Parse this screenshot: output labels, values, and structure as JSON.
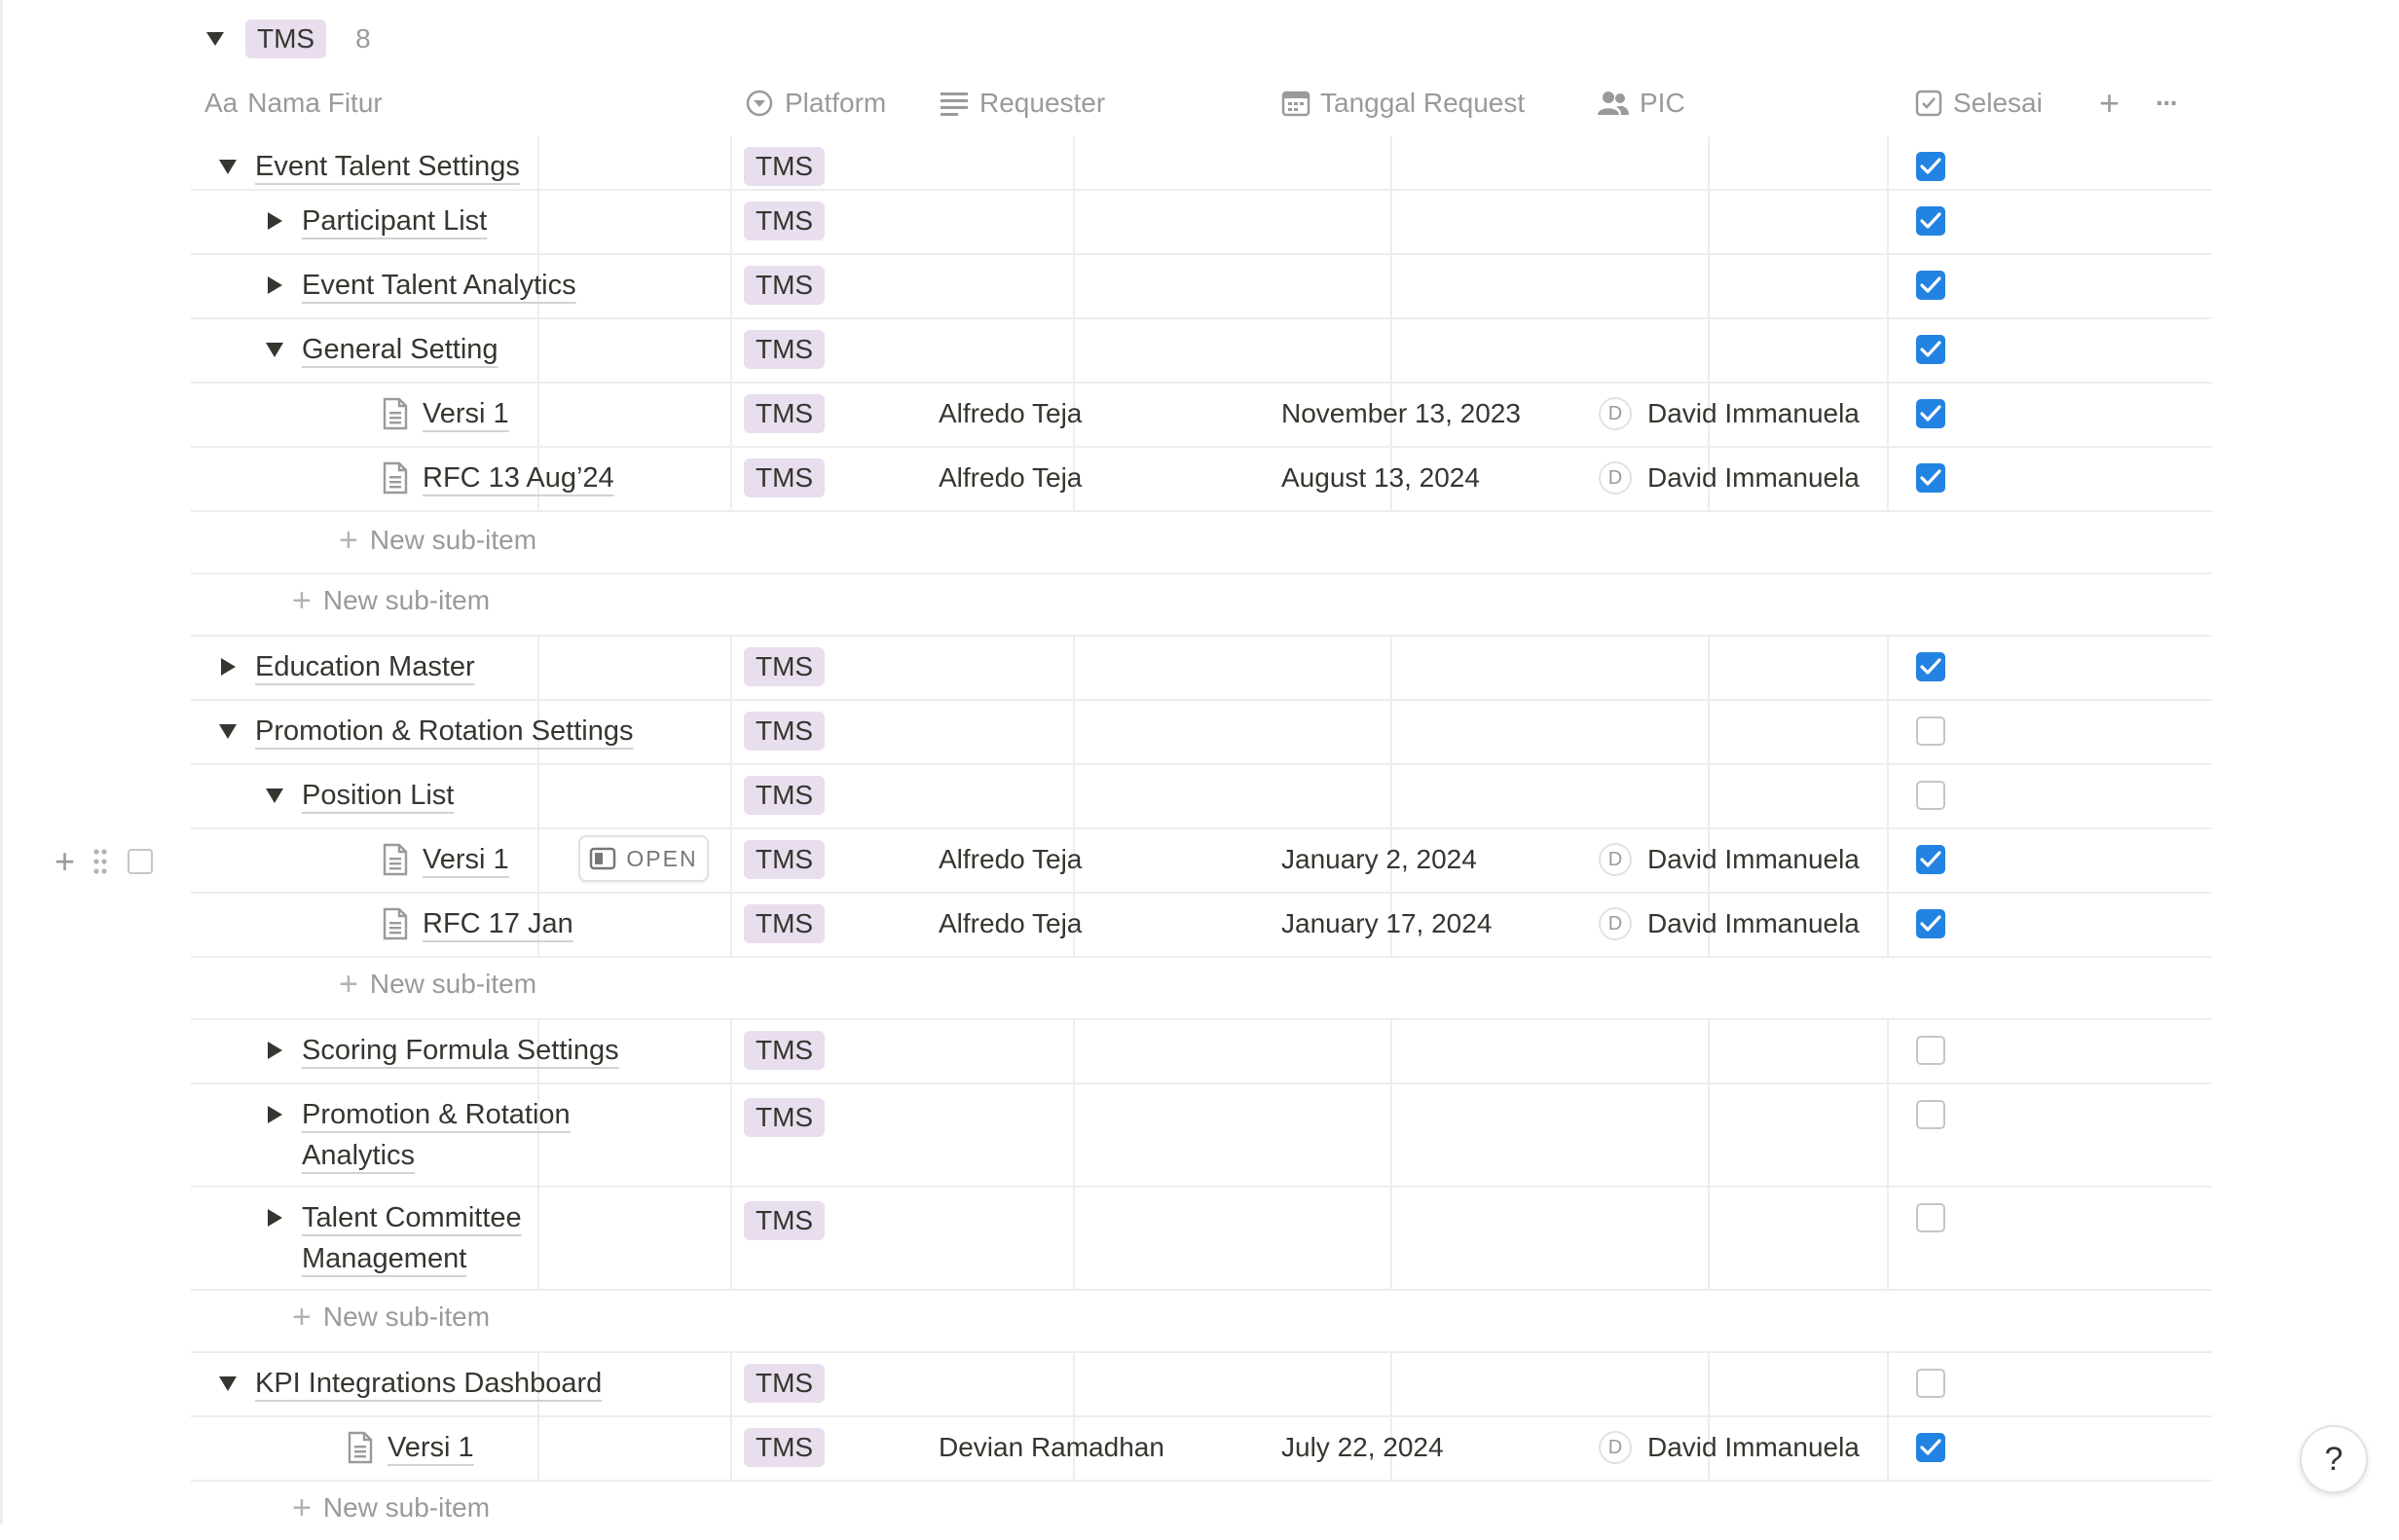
{
  "group": {
    "tag": "TMS",
    "count": "8"
  },
  "columns": {
    "name": "Nama Fitur",
    "name_icon": "Aa",
    "platform": "Platform",
    "requester": "Requester",
    "date": "Tanggal Request",
    "pic": "PIC",
    "done": "Selesai",
    "add": "+",
    "more": "···"
  },
  "open_label": "OPEN",
  "help_label": "?",
  "rows": [
    {
      "name": "Event Talent Settings",
      "platform": "TMS",
      "requester": "",
      "date": "",
      "pic": "",
      "done": true,
      "toggle": "open",
      "level": 1
    },
    {
      "name": "Participant List",
      "platform": "TMS",
      "requester": "",
      "date": "",
      "pic": "",
      "done": true,
      "toggle": "closed",
      "level": 2
    },
    {
      "name": "Event Talent Analytics",
      "platform": "TMS",
      "requester": "",
      "date": "",
      "pic": "",
      "done": true,
      "toggle": "closed",
      "level": 2
    },
    {
      "name": "General Setting",
      "platform": "TMS",
      "requester": "",
      "date": "",
      "pic": "",
      "done": true,
      "toggle": "open",
      "level": 2
    },
    {
      "name": "Versi 1",
      "platform": "TMS",
      "requester": "Alfredo Teja",
      "date": "November 13, 2023",
      "pic": "David Immanuela",
      "pic_initial": "D",
      "done": true,
      "toggle": "doc",
      "level": 3
    },
    {
      "name": "RFC 13 Aug’24",
      "platform": "TMS",
      "requester": "Alfredo Teja",
      "date": "August 13, 2024",
      "pic": "David Immanuela",
      "pic_initial": "D",
      "done": true,
      "toggle": "doc",
      "level": 3
    },
    {
      "name": "Education Master",
      "platform": "TMS",
      "requester": "",
      "date": "",
      "pic": "",
      "done": true,
      "toggle": "closed",
      "level": 1
    },
    {
      "name": "Promotion & Rotation Settings",
      "platform": "TMS",
      "requester": "",
      "date": "",
      "pic": "",
      "done": false,
      "toggle": "open",
      "level": 1
    },
    {
      "name": "Position List",
      "platform": "TMS",
      "requester": "",
      "date": "",
      "pic": "",
      "done": false,
      "toggle": "open",
      "level": 2
    },
    {
      "name": "Versi 1",
      "platform": "TMS",
      "requester": "Alfredo Teja",
      "date": "January 2, 2024",
      "pic": "David Immanuela",
      "pic_initial": "D",
      "done": true,
      "toggle": "doc",
      "level": 3
    },
    {
      "name": "RFC 17 Jan",
      "platform": "TMS",
      "requester": "Alfredo Teja",
      "date": "January 17, 2024",
      "pic": "David Immanuela",
      "pic_initial": "D",
      "done": true,
      "toggle": "doc",
      "level": 3
    },
    {
      "name": "Scoring Formula Settings",
      "platform": "TMS",
      "requester": "",
      "date": "",
      "pic": "",
      "done": false,
      "toggle": "closed",
      "level": 2
    },
    {
      "name": "Promotion & Rotation",
      "name_line2": "Analytics",
      "platform": "TMS",
      "requester": "",
      "date": "",
      "pic": "",
      "done": false,
      "toggle": "closed",
      "level": 2
    },
    {
      "name": "Talent Committee",
      "name_line2": "Management",
      "platform": "TMS",
      "requester": "",
      "date": "",
      "pic": "",
      "done": false,
      "toggle": "closed",
      "level": 2
    },
    {
      "name": "KPI Integrations Dashboard",
      "platform": "TMS",
      "requester": "",
      "date": "",
      "pic": "",
      "done": false,
      "toggle": "open",
      "level": 1
    },
    {
      "name": "Versi 1",
      "platform": "TMS",
      "requester": "Devian Ramadhan",
      "date": "July 22, 2024",
      "pic": "David Immanuela",
      "pic_initial": "D",
      "done": true,
      "toggle": "doc",
      "level": 2
    }
  ],
  "new_sub_item": "New sub-item"
}
